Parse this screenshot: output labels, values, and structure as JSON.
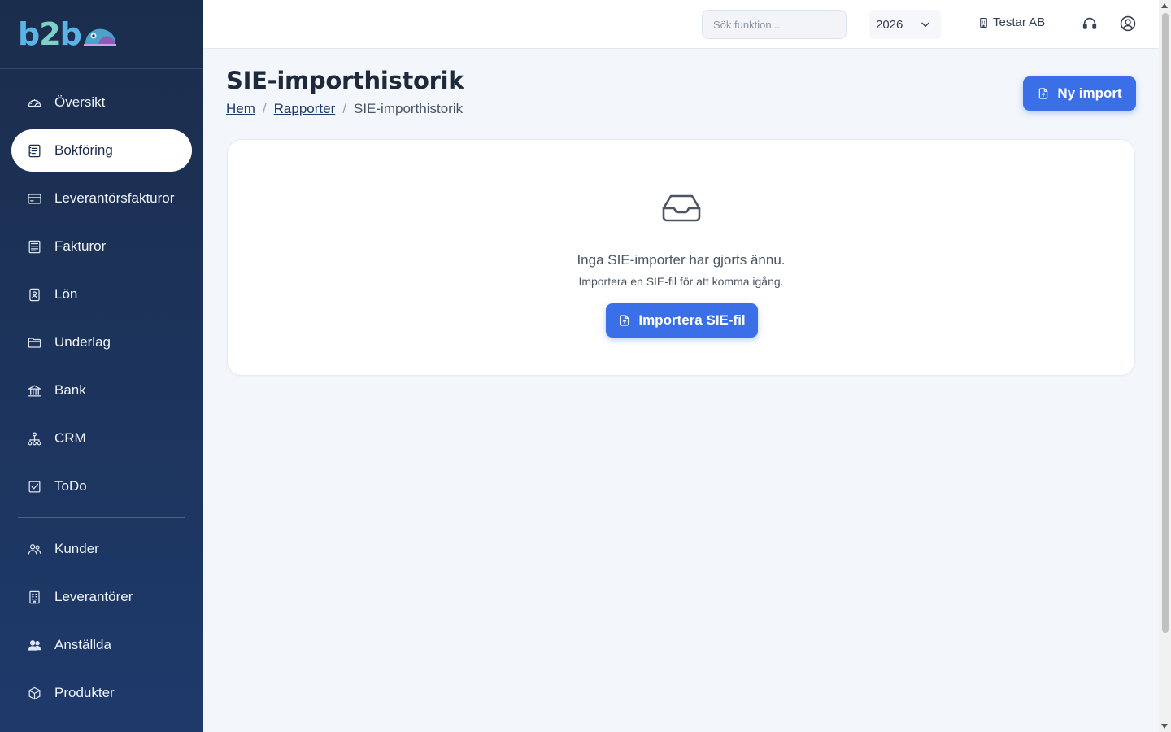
{
  "app": {
    "logo_text_b1": "b",
    "logo_text_2": "2",
    "logo_text_b2": "b",
    "brand_color": "#1b2d4c",
    "accent_color": "#3b6fe8"
  },
  "sidebar": {
    "items": [
      {
        "label": "Översikt",
        "icon": "dashboard-gauge-icon",
        "active": false
      },
      {
        "label": "Bokföring",
        "icon": "ledger-book-icon",
        "active": true
      },
      {
        "label": "Leverantörsfakturor",
        "icon": "credit-card-icon",
        "active": false
      },
      {
        "label": "Fakturor",
        "icon": "invoice-icon",
        "active": false
      },
      {
        "label": "Lön",
        "icon": "salary-badge-icon",
        "active": false
      },
      {
        "label": "Underlag",
        "icon": "folder-icon",
        "active": false
      },
      {
        "label": "Bank",
        "icon": "bank-icon",
        "active": false
      },
      {
        "label": "CRM",
        "icon": "network-icon",
        "active": false
      },
      {
        "label": "ToDo",
        "icon": "checkbox-icon",
        "active": false
      }
    ],
    "items2": [
      {
        "label": "Kunder",
        "icon": "users-icon"
      },
      {
        "label": "Leverantörer",
        "icon": "building-icon"
      },
      {
        "label": "Anställda",
        "icon": "employees-icon"
      },
      {
        "label": "Produkter",
        "icon": "box-icon"
      }
    ]
  },
  "topbar": {
    "search_placeholder": "Sök funktion...",
    "year": "2026",
    "company": "Testar AB",
    "support_icon": "headset-icon",
    "user_icon": "user-circle-icon"
  },
  "page": {
    "title": "SIE-importhistorik",
    "breadcrumb": {
      "home": "Hem",
      "reports": "Rapporter",
      "current": "SIE-importhistorik",
      "separator": "/"
    },
    "new_import_label": "Ny import"
  },
  "empty_state": {
    "icon": "inbox-icon",
    "title": "Inga SIE-importer har gjorts ännu.",
    "subtitle": "Importera en SIE-fil för att komma igång.",
    "button_label": "Importera SIE-fil"
  }
}
